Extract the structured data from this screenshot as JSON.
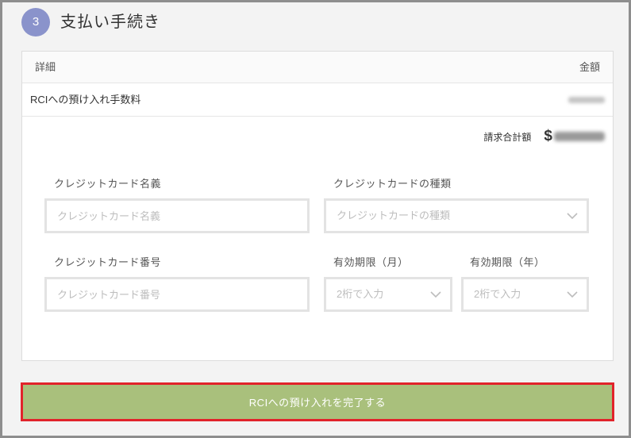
{
  "step": {
    "number": "3",
    "title": "支払い手続き"
  },
  "table": {
    "headers": {
      "detail": "詳細",
      "amount": "金額"
    },
    "rows": [
      {
        "label": "RCIへの預け入れ手数料"
      }
    ]
  },
  "total": {
    "label": "請求合計額",
    "currency": "$"
  },
  "form": {
    "card_name": {
      "label": "クレジットカード名義",
      "placeholder": "クレジットカード名義"
    },
    "card_type": {
      "label": "クレジットカードの種類",
      "placeholder": "クレジットカードの種類"
    },
    "card_number": {
      "label": "クレジットカード番号",
      "placeholder": "クレジットカード番号"
    },
    "expiry_month": {
      "label": "有効期限（月）",
      "placeholder": "2桁で入力"
    },
    "expiry_year": {
      "label": "有効期限（年）",
      "placeholder": "2桁で入力"
    }
  },
  "submit": {
    "label": "RCIへの預け入れを完了する"
  },
  "colors": {
    "step_circle": "#8a93cb",
    "submit_button": "#a9c07c",
    "highlight_border": "#e1232b",
    "background": "#f3f3f3"
  },
  "icons": {
    "select_arrow": "chevron-down-icon"
  }
}
